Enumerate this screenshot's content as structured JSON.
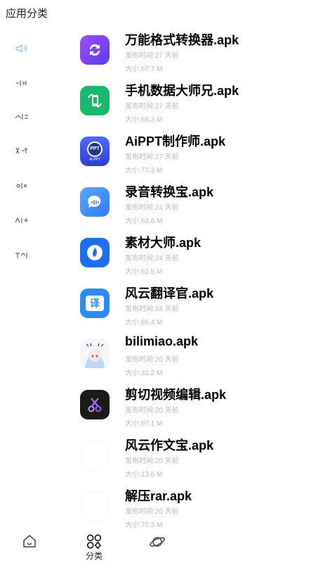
{
  "header": {
    "title": "应用分类"
  },
  "sidebar": {
    "items": [
      {
        "icon": "speaker-icon",
        "active": true
      },
      {
        "icon": "category-icon-2",
        "active": false
      },
      {
        "icon": "category-icon-3",
        "active": false
      },
      {
        "icon": "category-icon-4",
        "active": false
      },
      {
        "icon": "category-icon-5",
        "active": false
      },
      {
        "icon": "category-icon-6",
        "active": false
      },
      {
        "icon": "category-icon-7",
        "active": false
      }
    ]
  },
  "apps": [
    {
      "name": "万能格式转换器.apk",
      "date": "发布时间:27 天前",
      "size": "大小:67.7 M",
      "icon": "convert-icon",
      "color": "#7b3df2"
    },
    {
      "name": "手机数据大师兄.apk",
      "date": "发布时间:27 天前",
      "size": "大小:68.3 M",
      "icon": "phone-transfer-icon",
      "color": "#19b96c"
    },
    {
      "name": "AiPPT制作师.apk",
      "date": "发布时间:27 天前",
      "size": "大小:77.3 M",
      "icon": "ppt-icon",
      "color": "#3a5bff",
      "icon_text": "PPT",
      "icon_subtext": "AI PPT"
    },
    {
      "name": "录音转换宝.apk",
      "date": "发布时间:24 天前",
      "size": "大小:64.6 M",
      "icon": "voice-bubble-icon",
      "color": "#3d8bff"
    },
    {
      "name": "素材大师.apk",
      "date": "发布时间:24 天前",
      "size": "大小:61.5 M",
      "icon": "drop-icon",
      "color": "#1e6ff0"
    },
    {
      "name": "风云翻译官.apk",
      "date": "发布时间:24 天前",
      "size": "大小:86.4 M",
      "icon": "translate-icon",
      "color": "#2d8cf0",
      "icon_text": "译"
    },
    {
      "name": "bilimiao.apk",
      "date": "发布时间:20 天前",
      "size": "大小:32.2 M",
      "icon": "anime-avatar-icon",
      "color": "#f2f2f2"
    },
    {
      "name": "剪切视频编辑.apk",
      "date": "发布时间:20 天前",
      "size": "大小:97.1 M",
      "icon": "scissors-icon",
      "color": "#1a1a1a"
    },
    {
      "name": "风云作文宝.apk",
      "date": "发布时间:20 天前",
      "size": "大小:13.6 M",
      "icon": "blank-icon",
      "color": "#ffffff"
    },
    {
      "name": "解压rar.apk",
      "date": "发布时间:20 天前",
      "size": "大小:70.3 M",
      "icon": "blank-icon",
      "color": "#ffffff"
    }
  ],
  "bottom_nav": {
    "items": [
      {
        "icon": "home-icon",
        "label": ""
      },
      {
        "icon": "category-grid-icon",
        "label": "分类"
      },
      {
        "icon": "planet-icon",
        "label": ""
      }
    ]
  }
}
